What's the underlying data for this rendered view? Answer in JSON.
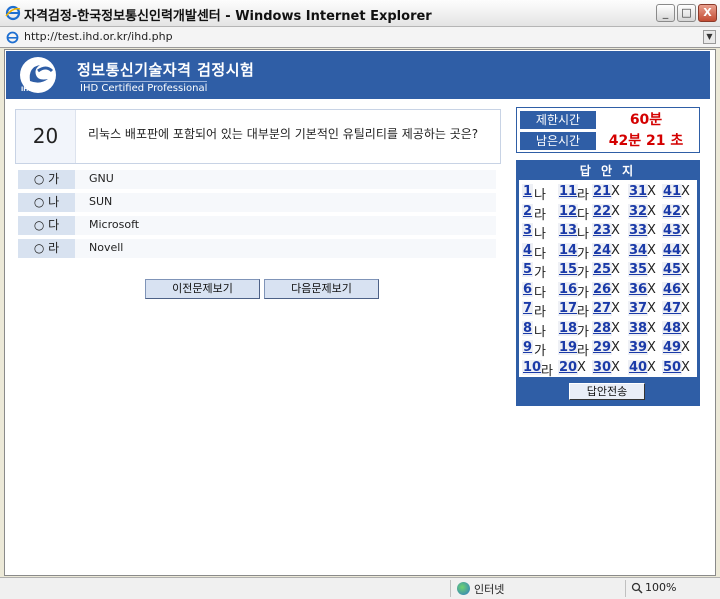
{
  "window": {
    "title": "자격검정-한국정보통신인력개발센터 - Windows Internet Explorer",
    "url": "http://test.ihd.or.kr/ihd.php",
    "minimize": "_",
    "maximize": "□",
    "close": "X",
    "dropdown": "▼"
  },
  "header": {
    "logo_text": "IHD-CP",
    "title": "정보통신기술자격 검정시험",
    "subtitle": "IHD Certified Professional"
  },
  "question": {
    "number": "20",
    "text": "리눅스 배포판에 포함되어 있는 대부분의 기본적인 유틸리티를 제공하는 곳은?"
  },
  "options": [
    {
      "label": "○ 가",
      "text": "GNU"
    },
    {
      "label": "○ 나",
      "text": "SUN"
    },
    {
      "label": "○ 다",
      "text": "Microsoft"
    },
    {
      "label": "○ 라",
      "text": "Novell"
    }
  ],
  "buttons": {
    "prev": "이전문제보기",
    "next": "다음문제보기",
    "submit": "답안전송"
  },
  "timer": {
    "limit_label": "제한시간",
    "limit_value": "60분",
    "remaining_label": "남은시간",
    "remaining_value": "42분 21 초"
  },
  "answer_sheet": {
    "title": "답 안 지",
    "rows": [
      [
        {
          "n": "1",
          "a": "나"
        },
        {
          "n": "11",
          "a": "라"
        },
        {
          "n": "21",
          "a": "X"
        },
        {
          "n": "31",
          "a": "X"
        },
        {
          "n": "41",
          "a": "X"
        }
      ],
      [
        {
          "n": "2",
          "a": "라"
        },
        {
          "n": "12",
          "a": "다"
        },
        {
          "n": "22",
          "a": "X"
        },
        {
          "n": "32",
          "a": "X"
        },
        {
          "n": "42",
          "a": "X"
        }
      ],
      [
        {
          "n": "3",
          "a": "나"
        },
        {
          "n": "13",
          "a": "나"
        },
        {
          "n": "23",
          "a": "X"
        },
        {
          "n": "33",
          "a": "X"
        },
        {
          "n": "43",
          "a": "X"
        }
      ],
      [
        {
          "n": "4",
          "a": "다"
        },
        {
          "n": "14",
          "a": "가"
        },
        {
          "n": "24",
          "a": "X"
        },
        {
          "n": "34",
          "a": "X"
        },
        {
          "n": "44",
          "a": "X"
        }
      ],
      [
        {
          "n": "5",
          "a": "가"
        },
        {
          "n": "15",
          "a": "가"
        },
        {
          "n": "25",
          "a": "X"
        },
        {
          "n": "35",
          "a": "X"
        },
        {
          "n": "45",
          "a": "X"
        }
      ],
      [
        {
          "n": "6",
          "a": "다"
        },
        {
          "n": "16",
          "a": "가"
        },
        {
          "n": "26",
          "a": "X"
        },
        {
          "n": "36",
          "a": "X"
        },
        {
          "n": "46",
          "a": "X"
        }
      ],
      [
        {
          "n": "7",
          "a": "라"
        },
        {
          "n": "17",
          "a": "라"
        },
        {
          "n": "27",
          "a": "X"
        },
        {
          "n": "37",
          "a": "X"
        },
        {
          "n": "47",
          "a": "X"
        }
      ],
      [
        {
          "n": "8",
          "a": "나"
        },
        {
          "n": "18",
          "a": "가"
        },
        {
          "n": "28",
          "a": "X"
        },
        {
          "n": "38",
          "a": "X"
        },
        {
          "n": "48",
          "a": "X"
        }
      ],
      [
        {
          "n": "9",
          "a": "가"
        },
        {
          "n": "19",
          "a": "라"
        },
        {
          "n": "29",
          "a": "X"
        },
        {
          "n": "39",
          "a": "X"
        },
        {
          "n": "49",
          "a": "X"
        }
      ],
      [
        {
          "n": "10",
          "a": "라"
        },
        {
          "n": "20",
          "a": "X"
        },
        {
          "n": "30",
          "a": "X"
        },
        {
          "n": "40",
          "a": "X"
        },
        {
          "n": "50",
          "a": "X"
        }
      ]
    ]
  },
  "statusbar": {
    "zone": "인터넷",
    "zoom": "100%"
  },
  "colors": {
    "brand": "#2f5ea6",
    "timer_value": "#d40000",
    "answer_link": "#1a3aa8"
  }
}
